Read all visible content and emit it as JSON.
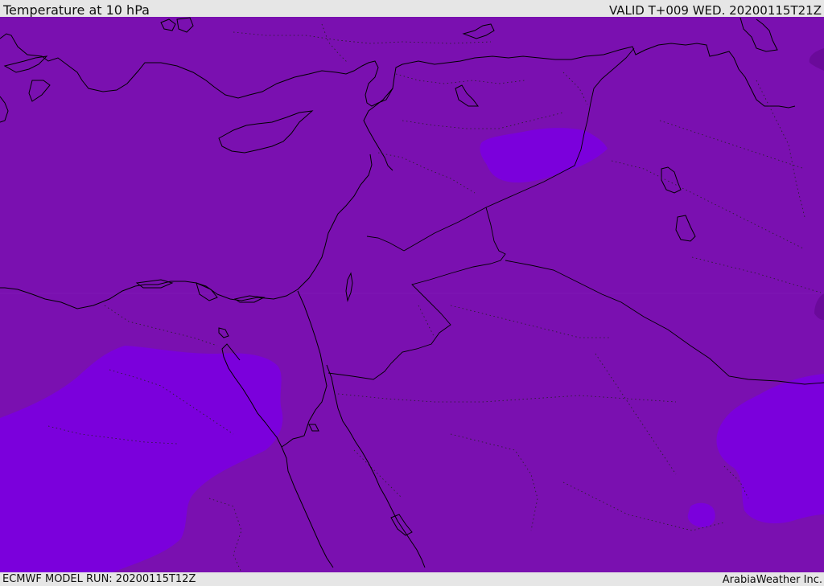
{
  "header": {
    "title": "Temperature at 10 hPa",
    "valid_time": "VALID T+009 WED. 20200115T21Z"
  },
  "footer": {
    "model_run": "ECMWF MODEL RUN: 20200115T12Z",
    "credit": "ArabiaWeather Inc."
  },
  "colors": {
    "field_base": "#7a10b0",
    "field_warm_band": "#7b00dc",
    "field_dark": "#6a0a9a",
    "coastline": "#000000",
    "panel_background": "#e6e6e6"
  }
}
